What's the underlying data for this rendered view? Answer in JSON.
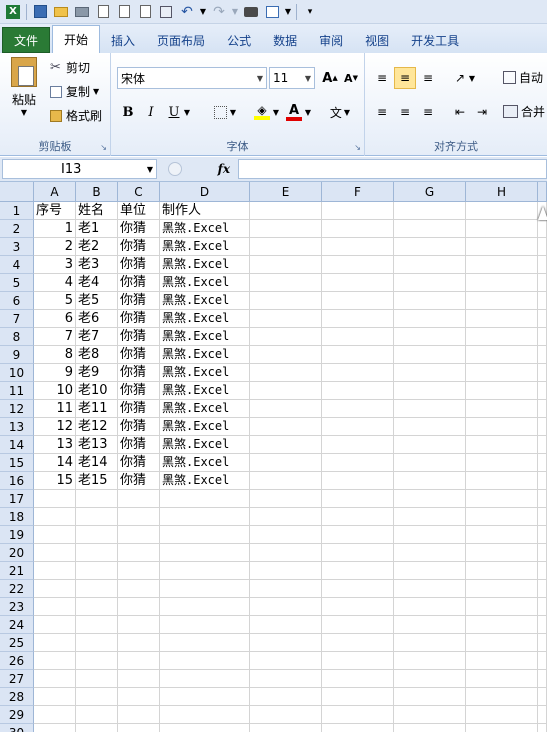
{
  "ribbon_tabs": [
    "文件",
    "开始",
    "插入",
    "页面布局",
    "公式",
    "数据",
    "审阅",
    "视图",
    "开发工具"
  ],
  "clipboard": {
    "paste": "粘贴",
    "cut": "剪切",
    "copy": "复制",
    "format_painter": "格式刷",
    "group_label": "剪贴板"
  },
  "font": {
    "name": "宋体",
    "size": "11",
    "bold": "B",
    "italic": "I",
    "underline": "U",
    "group_label": "字体",
    "phonetic": "文"
  },
  "alignment": {
    "wrap": "自动",
    "merge": "合并",
    "group_label": "对齐方式"
  },
  "namebox": "I13",
  "fx": "fx",
  "columns": [
    "A",
    "B",
    "C",
    "D",
    "E",
    "F",
    "G",
    "H"
  ],
  "rows": [
    "1",
    "2",
    "3",
    "4",
    "5",
    "6",
    "7",
    "8",
    "9",
    "10",
    "11",
    "12",
    "13",
    "14",
    "15",
    "16",
    "17",
    "18",
    "19",
    "20",
    "21",
    "22",
    "23",
    "24",
    "25",
    "26",
    "27",
    "28",
    "29",
    "30"
  ],
  "table": [
    [
      "序号",
      "姓名",
      "单位",
      "制作人"
    ],
    [
      "1",
      "老1",
      "你猜",
      "黑煞.Excel"
    ],
    [
      "2",
      "老2",
      "你猜",
      "黑煞.Excel"
    ],
    [
      "3",
      "老3",
      "你猜",
      "黑煞.Excel"
    ],
    [
      "4",
      "老4",
      "你猜",
      "黑煞.Excel"
    ],
    [
      "5",
      "老5",
      "你猜",
      "黑煞.Excel"
    ],
    [
      "6",
      "老6",
      "你猜",
      "黑煞.Excel"
    ],
    [
      "7",
      "老7",
      "你猜",
      "黑煞.Excel"
    ],
    [
      "8",
      "老8",
      "你猜",
      "黑煞.Excel"
    ],
    [
      "9",
      "老9",
      "你猜",
      "黑煞.Excel"
    ],
    [
      "10",
      "老10",
      "你猜",
      "黑煞.Excel"
    ],
    [
      "11",
      "老11",
      "你猜",
      "黑煞.Excel"
    ],
    [
      "12",
      "老12",
      "你猜",
      "黑煞.Excel"
    ],
    [
      "13",
      "老13",
      "你猜",
      "黑煞.Excel"
    ],
    [
      "14",
      "老14",
      "你猜",
      "黑煞.Excel"
    ],
    [
      "15",
      "老15",
      "你猜",
      "黑煞.Excel"
    ]
  ],
  "colors": {
    "file_tab": "#2a7a35",
    "header_bg": "#dbe5f4",
    "ribbon_text": "#15428b"
  }
}
